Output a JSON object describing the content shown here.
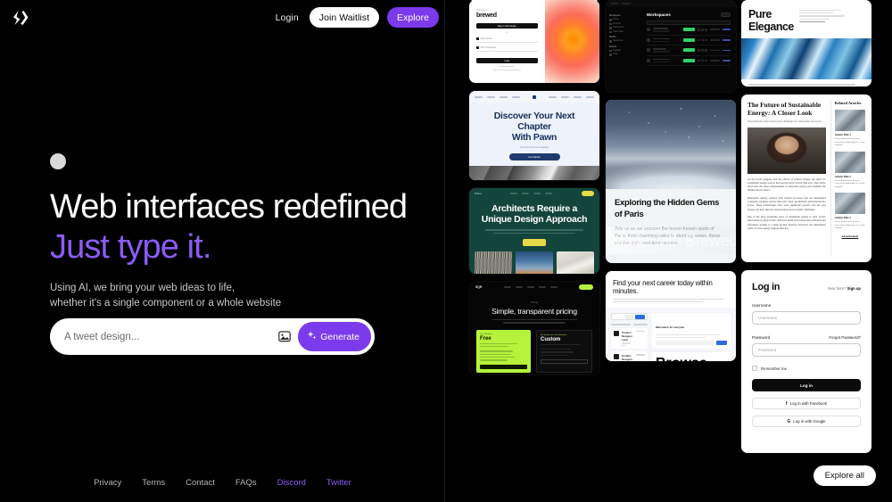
{
  "nav": {
    "logo_icon": "code-slash-logo",
    "login_label": "Login",
    "waitlist_label": "Join Waitlist",
    "explore_label": "Explore"
  },
  "hero": {
    "headline_line1": "Web interfaces redefined",
    "headline_line2": "Just type it.",
    "sub_line1": "Using AI, we bring your web ideas to life,",
    "sub_line2": "whether it's a single component or a whole website",
    "accent_color": "#8b5cf6"
  },
  "prompt": {
    "placeholder": "A tweet design...",
    "value": "",
    "image_icon": "image-icon",
    "sparkle_icon": "sparkles-icon",
    "generate_label": "Generate"
  },
  "footer": {
    "links": [
      {
        "label": "Privacy",
        "accent": false
      },
      {
        "label": "Terms",
        "accent": false
      },
      {
        "label": "Contact",
        "accent": false
      },
      {
        "label": "FAQs",
        "accent": false
      },
      {
        "label": "Discord",
        "accent": true
      },
      {
        "label": "Twitter",
        "accent": true
      }
    ]
  },
  "gallery": {
    "explore_all_label": "Explore all",
    "watermark": "Made with Brewed",
    "cards": {
      "brewed": {
        "eyebrow": "Welcome to",
        "brand": "brewed",
        "sso_button": "Sign in with Google",
        "divider": "or",
        "field_email": "Enter Email",
        "field_password": "Enter Password",
        "cta": "Login",
        "foot1": "Forgot password?",
        "foot2": "Don't have an account? Sign up"
      },
      "workspace": {
        "title": "Workspaces",
        "nav_groups": [
          "Workspace",
          "Studio",
          "Shared"
        ],
        "nav_items": [
          "Home",
          "Projects",
          "Documents",
          "Team Chat",
          "Resources",
          "Reference",
          "Settings",
          "Help"
        ],
        "rows": [
          "Website A: Creative",
          "Website B: Campaign",
          "Website C: Launch",
          "Website D: Mobile"
        ],
        "status": "Active"
      },
      "pure_elegance": {
        "title_line1": "Pure",
        "title_line2": "Elegance",
        "caption": "Experience unparalleled craftsmanship and exceptional durability that sets our products apart."
      },
      "pawn": {
        "headline_line1": "Discover Your Next Chapter",
        "headline_line2": "With Pawn",
        "sub": "Your home for new chapters",
        "cta": "Get Started"
      },
      "paris": {
        "title": "Exploring the Hidden Gems of Paris",
        "body": "Join us as we uncover the lesser-known spots of Paris, from charming cafes to stunning views, these are the city's best kept secrets."
      },
      "energy": {
        "title": "The Future of Sustainable Energy: A Closer Look",
        "deck": "Exploring the innovations and challenges in renewable resources",
        "paragraph1": "As the world grapples with the effects of climate change, the quest for sustainable energy sources has become more critical than ever. This article showcases the latest advancements in renewable energy and examines the hurdles that lie ahead.",
        "paragraph2": "Renewable energy, derived from natural processes that are replenished constantly, includes sources like solar, wind, geothermal, and hydroelectric power. These technologies have seen significant growth over the past decade, but they still face technological and economic challenges.",
        "paragraph3": "One of the most promising areas of sustainable energy is solar power. Innovations in photovoltaic cells have made solar panels more efficient and affordable, leading to a surge in their adoption. However, the intermittent nature of solar energy requires effective",
        "sidebar_title": "Related Articles",
        "related": [
          {
            "title": "Article Title 1",
            "snippet": "Lorem ipsum dolor sit amet, consectetur adipiscing elit, sed do eiusmod."
          },
          {
            "title": "Article Title 2",
            "snippet": "Lorem ipsum dolor sit amet, consectetur adipiscing elit, sed do eiusmod."
          },
          {
            "title": "Article Title 3",
            "snippet": "Lorem ipsum dolor sit amet, consectetur adipiscing elit, sed do eiusmod."
          }
        ],
        "advertisement": "Advertisement"
      },
      "architects": {
        "headline_line1": "Architects Require a",
        "headline_line2": "Unique Design Approach",
        "cta": "Explore"
      },
      "pricing": {
        "eyebrow": "Pricing",
        "headline": "Simple, transparent pricing",
        "free_tag": "For individuals",
        "free_name": "Free",
        "free_cta": "Get Started",
        "custom_tag": "For businesses and enterprise",
        "custom_name": "Custom",
        "custom_cta": "Contact Sales"
      },
      "careers": {
        "headline": "Find your next career today within minutes.",
        "search_btn": "Search",
        "jobs": [
          {
            "title": "Product Designer Lead"
          },
          {
            "title": "Graphic Designer"
          },
          {
            "title": "Senior Visual Designer"
          }
        ],
        "alert_title": "Want alerts for new jobs",
        "alert_btn": "Subscribe",
        "categories_title": "Browse categories"
      },
      "login": {
        "title": "Log in",
        "new_here": "New here?",
        "sign_up": "Sign up",
        "username_label": "Username",
        "username_placeholder": "Username",
        "password_label": "Password",
        "password_placeholder": "Password",
        "forgot": "Forgot Password?",
        "remember": "Remember me",
        "login_btn": "Log in",
        "facebook_btn": "Log in with Facebook",
        "facebook_icon": "facebook-icon",
        "google_btn": "Log in with Google",
        "google_icon": "google-icon"
      }
    }
  }
}
